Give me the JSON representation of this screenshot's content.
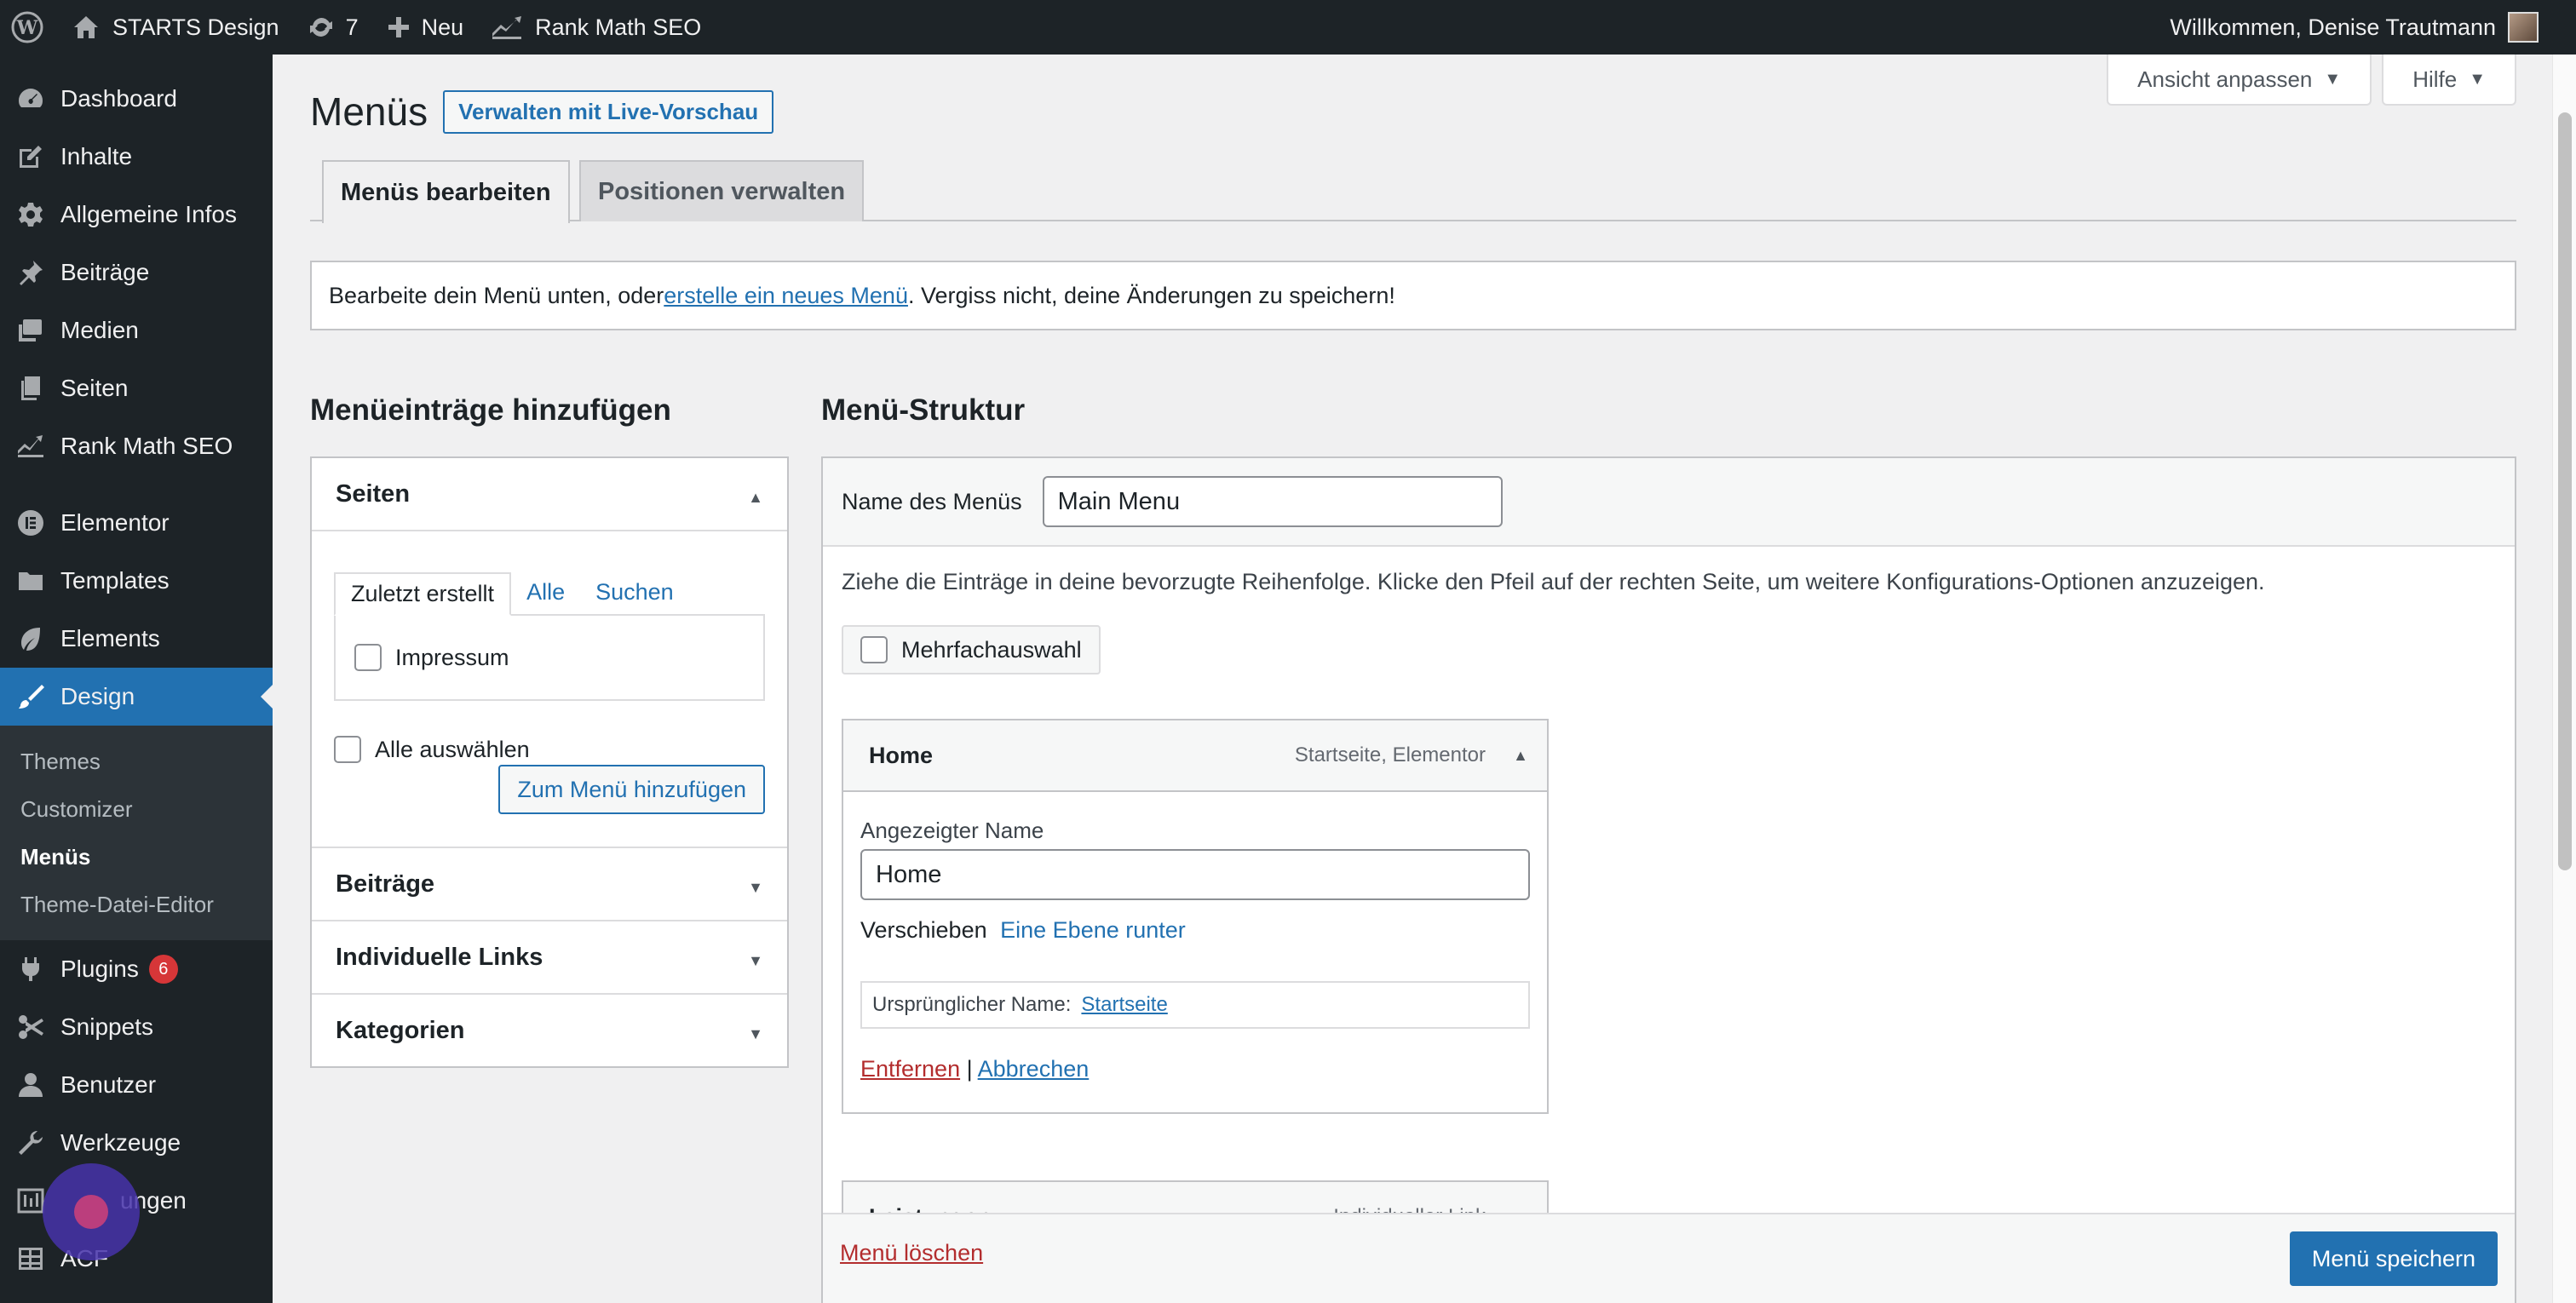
{
  "adminbar": {
    "site_name": "STARTS Design",
    "updates_count": "7",
    "new_label": "Neu",
    "seo_label": "Rank Math SEO",
    "greeting": "Willkommen, Denise Trautmann"
  },
  "sidebar": {
    "items": [
      {
        "label": "Dashboard",
        "icon": "dashboard-icon"
      },
      {
        "label": "Inhalte",
        "icon": "edit-icon"
      },
      {
        "label": "Allgemeine Infos",
        "icon": "gear-icon"
      },
      {
        "label": "Beiträge",
        "icon": "pin-icon"
      },
      {
        "label": "Medien",
        "icon": "media-icon"
      },
      {
        "label": "Seiten",
        "icon": "pages-icon"
      },
      {
        "label": "Rank Math SEO",
        "icon": "rankmath-icon"
      },
      {
        "label": "Elementor",
        "icon": "elementor-icon"
      },
      {
        "label": "Templates",
        "icon": "folder-icon"
      },
      {
        "label": "Elements",
        "icon": "leaf-icon"
      },
      {
        "label": "Design",
        "icon": "brush-icon"
      }
    ],
    "design_submenu": [
      "Themes",
      "Customizer",
      "Menüs",
      "Theme-Datei-Editor"
    ],
    "items_after": [
      {
        "label": "Plugins",
        "icon": "plugin-icon",
        "badge": "6"
      },
      {
        "label": "Snippets",
        "icon": "scissors-icon"
      },
      {
        "label": "Benutzer",
        "icon": "user-icon"
      },
      {
        "label": "Werkzeuge",
        "icon": "wrench-icon"
      },
      {
        "label": "Einstellungen",
        "visible_label": "ungen",
        "icon": "settings-icon"
      },
      {
        "label": "ACF",
        "icon": "table-icon"
      }
    ]
  },
  "screen_options": {
    "view_label": "Ansicht anpassen",
    "help_label": "Hilfe"
  },
  "page": {
    "title": "Menüs",
    "live_preview": "Verwalten mit Live-Vorschau",
    "tabs": [
      "Menüs bearbeiten",
      "Positionen verwalten"
    ],
    "notice_before": "Bearbeite dein Menü unten, oder ",
    "notice_link": "erstelle ein neues Menü",
    "notice_after": ". Vergiss nicht, deine Änderungen zu speichern!"
  },
  "add_items": {
    "heading": "Menüeinträge hinzufügen",
    "pages_label": "Seiten",
    "subtabs": [
      "Zuletzt erstellt",
      "Alle",
      "Suchen"
    ],
    "page_item": "Impressum",
    "select_all": "Alle auswählen",
    "add_button": "Zum Menü hinzufügen",
    "sections": [
      "Beiträge",
      "Individuelle Links",
      "Kategorien"
    ]
  },
  "structure": {
    "heading": "Menü-Struktur",
    "name_label": "Name des Menüs",
    "name_value": "Main Menu",
    "instructions": "Ziehe die Einträge in deine bevorzugte Reihenfolge. Klicke den Pfeil auf der rechten Seite, um weitere Konfigurations-Optionen anzuzeigen.",
    "multi_select": "Mehrfachauswahl",
    "item1": {
      "title": "Home",
      "type": "Startseite, Elementor",
      "display_name_label": "Angezeigter Name",
      "display_name_value": "Home",
      "move_label": "Verschieben",
      "move_link": "Eine Ebene runter",
      "original_label": "Ursprünglicher Name:",
      "original_link": "Startseite",
      "remove": "Entfernen",
      "separator": "|",
      "cancel": "Abbrechen"
    },
    "item2": {
      "title": "Leistungen",
      "type": "Individueller Link"
    },
    "delete_menu": "Menü löschen",
    "save_button": "Menü speichern"
  }
}
